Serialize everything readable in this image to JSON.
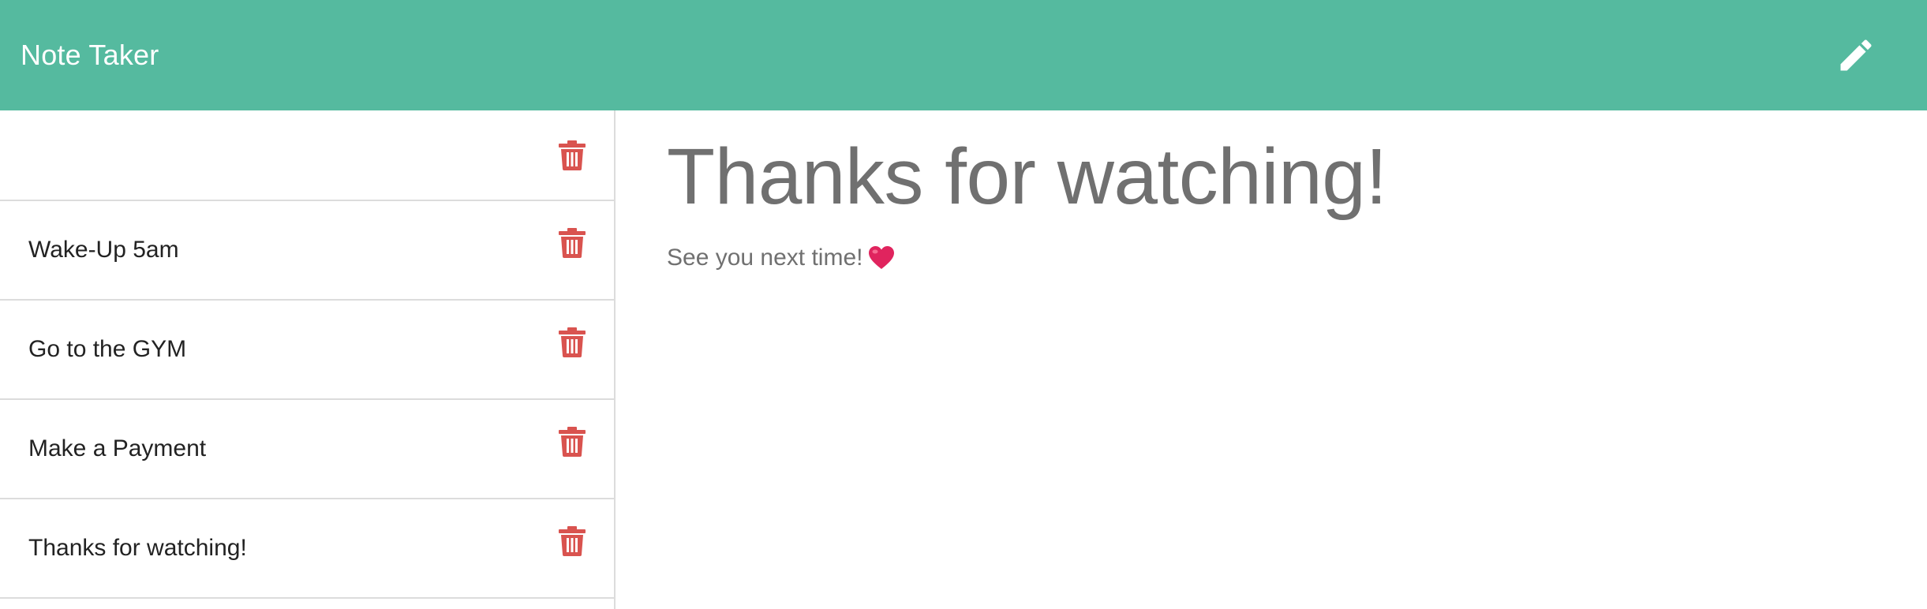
{
  "navbar": {
    "brand": "Note Taker",
    "new_note_icon": "pencil-icon",
    "color": "#55ba9f"
  },
  "sidebar": {
    "delete_icon": "trash-icon",
    "delete_color": "#d9534f",
    "notes": [
      {
        "title": ""
      },
      {
        "title": "Wake-Up 5am"
      },
      {
        "title": "Go to the GYM"
      },
      {
        "title": "Make a Payment"
      },
      {
        "title": "Thanks for watching!"
      }
    ]
  },
  "main": {
    "note_title": "Thanks for watching!",
    "note_text": "See you next time!",
    "emoji_icon": "heart-icon"
  }
}
